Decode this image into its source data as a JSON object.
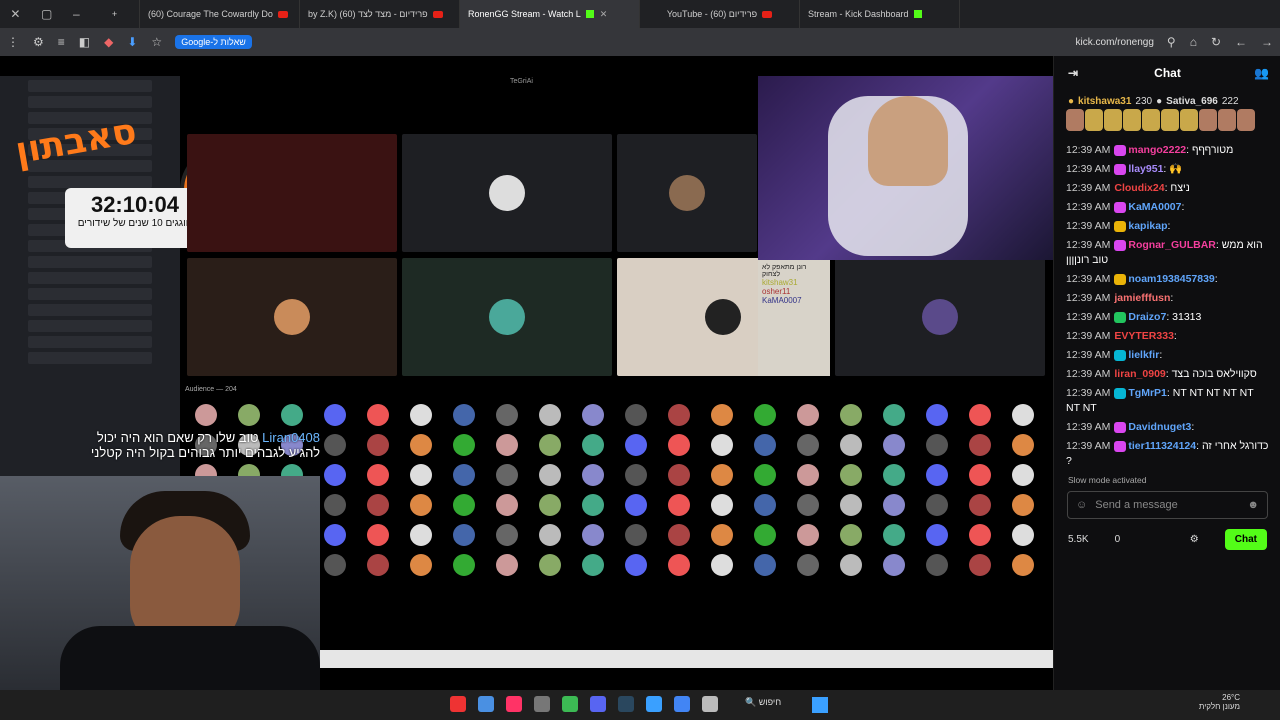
{
  "browser": {
    "tabs": [
      {
        "label": "(60) Courage The Cowardly Do",
        "type": "yt"
      },
      {
        "label": "by Z.K) (60) פרידיום - מצד לצד",
        "type": "yt"
      },
      {
        "label": "RonenGG Stream - Watch L",
        "type": "kick",
        "active": true
      },
      {
        "label": "YouTube - (60) פרידיום",
        "type": "yt"
      },
      {
        "label": "Stream - Kick Dashboard",
        "type": "kick"
      }
    ],
    "bookmark_chip": "Google-שאלות ל",
    "url": "kick.com/ronengg"
  },
  "stream": {
    "logo_text": "סאבתון",
    "timer": "32:10:04",
    "timer_subtitle": "חוגגים 10 שנים של שידורים",
    "grid_label": "TeGriAi",
    "audience_label": "Audience — 204",
    "subtitle_user": "Liran0408",
    "subtitle_line1": "טוב שלו רק שאם הוא היה יכול",
    "subtitle_line2": "להגיע לגבהים יותר גבוהים בקול היה קטלני",
    "overlay_chat": [
      "kitshaw31",
      "osher11",
      "KaMA0007"
    ],
    "overlay_title": "רונן מתאפק לא לצחוק"
  },
  "chat": {
    "title": "Chat",
    "pinned": [
      {
        "name": "kitshawa31",
        "count": "230"
      },
      {
        "name": "Sativa_696",
        "count": "222"
      }
    ],
    "messages": [
      {
        "ts": "12:39 AM",
        "user": "mango2222",
        "color": "#f43f9e",
        "text": "מטורףףף",
        "badge": "#d946ef"
      },
      {
        "ts": "12:39 AM",
        "user": "llay951",
        "color": "#a78bfa",
        "text": "🙌",
        "badge": "#d946ef"
      },
      {
        "ts": "12:39 AM",
        "user": "Cloudix24",
        "color": "#ef4444",
        "text": "ניצח",
        "badge": ""
      },
      {
        "ts": "12:39 AM",
        "user": "KaMA0007",
        "color": "#60a5fa",
        "text": "",
        "badge": "#d946ef"
      },
      {
        "ts": "12:39 AM",
        "user": "kapikap",
        "color": "#60a5fa",
        "text": "",
        "badge": "#eab308"
      },
      {
        "ts": "12:39 AM",
        "user": "Rognar_GULBAR",
        "color": "#f43f9e",
        "text": "הוא ממש טוב רונןןןן",
        "badge": "#d946ef"
      },
      {
        "ts": "12:39 AM",
        "user": "noam1938457839",
        "color": "#60a5fa",
        "text": "",
        "badge": "#eab308"
      },
      {
        "ts": "12:39 AM",
        "user": "jamiefffusn",
        "color": "#f87171",
        "text": "",
        "badge": ""
      },
      {
        "ts": "12:39 AM",
        "user": "Draizo7",
        "color": "#60a5fa",
        "text": "31313",
        "badge": "#22c55e"
      },
      {
        "ts": "12:39 AM",
        "user": "EVYTER333",
        "color": "#ef4444",
        "text": "",
        "badge": ""
      },
      {
        "ts": "12:39 AM",
        "user": "lielkfir",
        "color": "#60a5fa",
        "text": "",
        "badge": "#06b6d4"
      },
      {
        "ts": "12:39 AM",
        "user": "liran_0909",
        "color": "#ef4444",
        "text": "סקווילאס בוכה בצד",
        "badge": ""
      },
      {
        "ts": "12:39 AM",
        "user": "TgMrP1",
        "color": "#60a5fa",
        "text": "NT NT NT NT NT NT NT",
        "badge": "#06b6d4"
      },
      {
        "ts": "12:39 AM",
        "user": "Davidnuget3",
        "color": "#60a5fa",
        "text": "",
        "badge": "#d946ef"
      },
      {
        "ts": "12:39 AM",
        "user": "tier111324124",
        "color": "#60a5fa",
        "text": "כדורגל אחרי זה ?",
        "badge": "#d946ef"
      }
    ],
    "slow_mode": "Slow mode activated",
    "input_placeholder": "Send a message",
    "viewers": "5.5K",
    "zero": "0",
    "send_label": "Chat"
  },
  "taskbar": {
    "search": "חיפוש",
    "temp": "26°C",
    "weather_desc": "מעונן חלקית"
  }
}
